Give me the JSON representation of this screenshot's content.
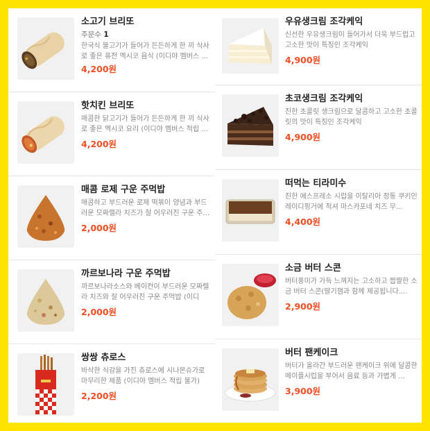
{
  "colors": {
    "frame": "#FFE400",
    "price": "#f04e23"
  },
  "left_items": [
    {
      "name": "소고기 브리또",
      "qty_label": "주문수",
      "qty_value": "1",
      "desc": "한국식 불고기가 들어가 든든하게 한 끼 식사로 좋은 퓨전 멕시코 음식 (이디야 멤버스 ...",
      "price": "4,200원",
      "icon": "beef-burrito-image"
    },
    {
      "name": "핫치킨 브리또",
      "desc": "매콤한 닭고기가 들어가 든든하게 한 끼 식사로 좋은 멕시코 요리 (이디야 멤버스 적립 ...",
      "price": "4,200원",
      "icon": "chicken-burrito-image"
    },
    {
      "name": "매콤 로제 구운 주먹밥",
      "desc": "매콤하고 부드러운 로제 떡볶이 양념과 부드러운 모짜렐라 치즈가 잘 어우러진 구운 주...",
      "price": "2,000원",
      "icon": "rose-rice-ball-image"
    },
    {
      "name": "까르보나라 구운 주먹밥",
      "desc": "까르보나라소스와 베이컨이 부드러운 모짜렐라 치즈와 잘 어우러진 구운 주먹밥 (이디야...",
      "price": "2,000원",
      "icon": "carbonara-rice-ball-image"
    },
    {
      "name": "쌍쌍 츄로스",
      "desc": "바삭한 식감을 가진 츄로스에 시나몬슈가로 마무리한 제품 (이디야 멤버스 적립 불가)",
      "price": "2,200원",
      "icon": "churros-image"
    }
  ],
  "right_items": [
    {
      "name": "우유생크림 조각케익",
      "desc": "신선한 우유생크림이 들어가서 더욱 부드럽고 고소한 맛이 특징인 조각케익",
      "price": "4,900원",
      "icon": "cream-cake-image"
    },
    {
      "name": "초코생크림 조각케익",
      "desc": "진한 초콜릿 생크림으로 달콤하고 고소한 초콜릿의 맛이 특징인 조각케익",
      "price": "4,900원",
      "icon": "choco-cake-image"
    },
    {
      "name": "떠먹는 티라미수",
      "desc": "진한 에스프레소 시럽을 이탈리아 정통 쿠키인 레이디핑거에 적셔 마스카포네 치즈 무...",
      "price": "4,400원",
      "icon": "tiramisu-image"
    },
    {
      "name": "소금 버터 스콘",
      "desc": "버터풍미가 가득 느껴지는 고소하고 짭짤한 소금 버터 스콘(딸기잼과 함께 제공됩니다....",
      "price": "2,900원",
      "icon": "scone-image"
    },
    {
      "name": "버터 팬케이크",
      "desc": "버터가 올라간 부드러운 팬케이크 위에 달콤한 메이플시럽을 부어서 음료 등과 가볍게 ...",
      "price": "3,900원",
      "icon": "pancake-image"
    }
  ]
}
